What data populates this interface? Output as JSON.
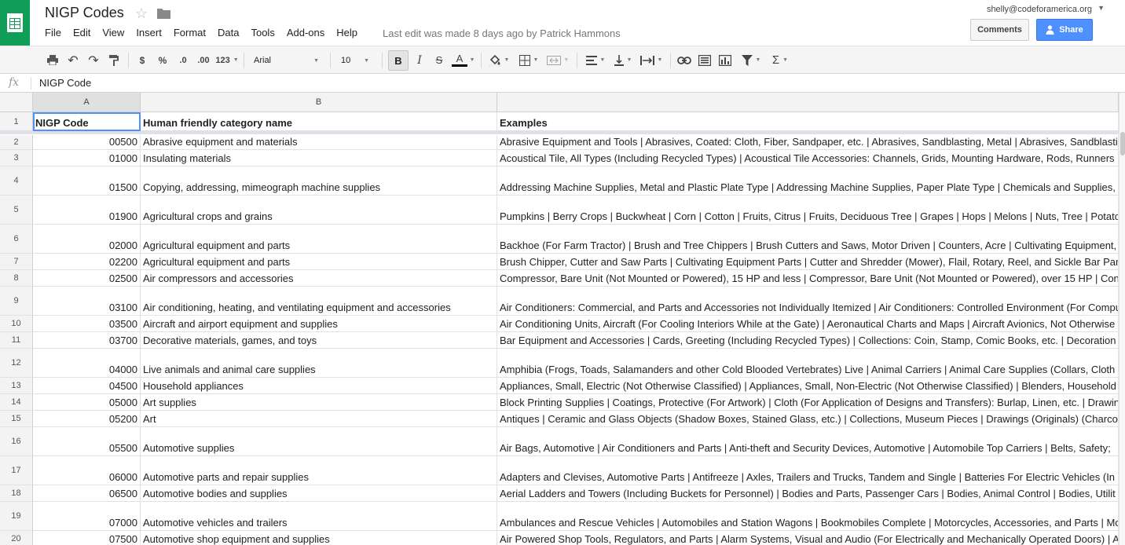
{
  "header": {
    "doc_title": "NIGP Codes",
    "last_edit": "Last edit was made 8 days ago by Patrick Hammons",
    "user_email": "shelly@codeforamerica.org",
    "comments_label": "Comments",
    "share_label": "Share",
    "brand_color": "#0f9d58",
    "share_color": "#4d90fe"
  },
  "menu": [
    "File",
    "Edit",
    "View",
    "Insert",
    "Format",
    "Data",
    "Tools",
    "Add-ons",
    "Help"
  ],
  "toolbar": {
    "currency": "$",
    "percent": "%",
    "dec_decrease": ".0",
    "dec_increase": ".00",
    "more_formats": "123",
    "font": "Arial",
    "font_size": "10",
    "bold": "B",
    "italic": "I",
    "strike": "S",
    "text_color": "A",
    "functions": "Σ"
  },
  "formula_bar": {
    "fx": "fx",
    "value": "NIGP Code"
  },
  "columns": [
    "A",
    "B",
    ""
  ],
  "rows": [
    {
      "n": "1",
      "a": "NIGP Code",
      "b": "Human friendly category name",
      "c": "Examples"
    },
    {
      "n": "2",
      "a": "00500",
      "b": "Abrasive equipment and materials",
      "c": "Abrasive Equipment and Tools | Abrasives, Coated: Cloth, Fiber, Sandpaper, etc. | Abrasives, Sandblasting, Metal | Abrasives, Sandblasting"
    },
    {
      "n": "3",
      "a": "01000",
      "b": "Insulating materials",
      "c": "Acoustical Tile, All Types (Including Recycled Types) | Acoustical Tile Accessories: Channels, Grids, Mounting Hardware, Rods, Runners"
    },
    {
      "n": "4",
      "a": "01500",
      "b": "Copying, addressing, mimeograph machine supplies",
      "c": "Addressing Machine Supplies, Metal and Plastic Plate Type | Addressing Machine Supplies, Paper Plate Type | Chemicals and Supplies,"
    },
    {
      "n": "5",
      "a": "01900",
      "b": "Agricultural crops and grains",
      "c": "Pumpkins | Berry Crops | Buckwheat | Corn | Cotton | Fruits, Citrus | Fruits, Deciduous Tree | Grapes | Hops | Melons | Nuts, Tree | Potato"
    },
    {
      "n": "6",
      "a": "02000",
      "b": "Agricultural equipment and parts",
      "c": "Backhoe (For Farm Tractor) | Brush and Tree Chippers | Brush Cutters and Saws, Motor Driven | Counters, Acre | Cultivating Equipment,"
    },
    {
      "n": "7",
      "a": "02200",
      "b": "Agricultural equipment and parts",
      "c": "Brush Chipper, Cutter and Saw Parts | Cultivating Equipment Parts | Cutter and Shredder (Mower), Flail, Rotary, Reel, and Sickle Bar Par"
    },
    {
      "n": "8",
      "a": "02500",
      "b": "Air compressors and accessories",
      "c": "Compressor, Bare Unit (Not Mounted or Powered), 15 HP and less | Compressor, Bare Unit (Not Mounted or Powered), over 15 HP | Con"
    },
    {
      "n": "9",
      "a": "03100",
      "b": "Air conditioning, heating, and ventilating equipment and accessories",
      "c": "Air Conditioners: Commercial, and Parts and Accessories not Individually Itemized | Air Conditioners: Controlled Environment (For Compu"
    },
    {
      "n": "10",
      "a": "03500",
      "b": "Aircraft and airport equipment and supplies",
      "c": "Air Conditioning Units, Aircraft (For Cooling Interiors While at the Gate) | Aeronautical Charts and Maps | Aircraft Avionics, Not Otherwise"
    },
    {
      "n": "11",
      "a": "03700",
      "b": "Decorative materials, games, and toys",
      "c": "Bar Equipment and Accessories | Cards, Greeting (Including Recycled Types) | Collections: Coin, Stamp, Comic Books, etc. | Decoration"
    },
    {
      "n": "12",
      "a": "04000",
      "b": "Live animals and animal care supplies",
      "c": "Amphibia (Frogs, Toads, Salamanders and other Cold Blooded Vertebrates) Live | Animal Carriers | Animal Care Supplies (Collars, Cloth"
    },
    {
      "n": "13",
      "a": "04500",
      "b": "Household appliances",
      "c": "Appliances, Small, Electric (Not Otherwise Classified) | Appliances, Small, Non-Electric (Not Otherwise Classified) | Blenders, Household"
    },
    {
      "n": "14",
      "a": "05000",
      "b": "Art supplies",
      "c": "Block Printing Supplies | Coatings, Protective (For Artwork) | Cloth (For Application of Designs and Transfers): Burlap, Linen, etc. | Drawin"
    },
    {
      "n": "15",
      "a": "05200",
      "b": "Art",
      "c": "Antiques | Ceramic and Glass Objects (Shadow Boxes, Stained Glass, etc.) | Collections, Museum Pieces | Drawings (Originals) (Charco"
    },
    {
      "n": "16",
      "a": "05500",
      "b": "Automotive supplies",
      "c": "Air Bags, Automotive | Air Conditioners and Parts | Anti-theft and Security Devices, Automotive | Automobile Top Carriers | Belts, Safety;"
    },
    {
      "n": "17",
      "a": "06000",
      "b": "Automotive parts and repair supplies",
      "c": "Adapters and Clevises, Automotive Parts | Antifreeze | Axles, Trailers and Trucks, Tandem and Single | Batteries For Electric Vehicles (In"
    },
    {
      "n": "18",
      "a": "06500",
      "b": "Automotive bodies and supplies",
      "c": "Aerial Ladders and Towers (Including Buckets for Personnel) | Bodies and Parts, Passenger Cars | Bodies, Animal Control | Bodies, Utilit"
    },
    {
      "n": "19",
      "a": "07000",
      "b": "Automotive vehicles and trailers",
      "c": "Ambulances and Rescue Vehicles | Automobiles and Station Wagons | Bookmobiles Complete | Motorcycles, Accessories, and Parts | Mo"
    },
    {
      "n": "20",
      "a": "07500",
      "b": "Automotive shop equipment and supplies",
      "c": "Air Powered Shop Tools, Regulators, and Parts | Alarm Systems, Visual and Audio (For Electrically and Mechanically Operated Doors) | A"
    }
  ]
}
